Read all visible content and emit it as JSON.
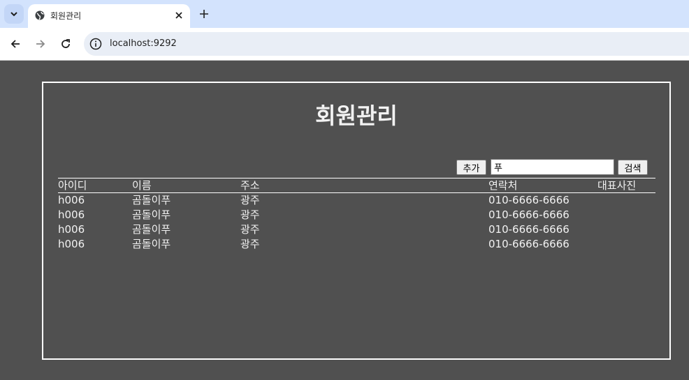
{
  "browser": {
    "tab_title": "회원관리",
    "url": "localhost:9292"
  },
  "page": {
    "title": "회원관리",
    "add_label": "추가",
    "search_value": "푸",
    "search_label": "검색",
    "columns": [
      "아이디",
      "이름",
      "주소",
      "연락처",
      "대표사진"
    ],
    "rows": [
      {
        "id": "h006",
        "name": "곰돌이푸",
        "addr": "광주",
        "tel": "010-6666-6666"
      },
      {
        "id": "h006",
        "name": "곰돌이푸",
        "addr": "광주",
        "tel": "010-6666-6666"
      },
      {
        "id": "h006",
        "name": "곰돌이푸",
        "addr": "광주",
        "tel": "010-6666-6666"
      },
      {
        "id": "h006",
        "name": "곰돌이푸",
        "addr": "광주",
        "tel": "010-6666-6666"
      }
    ]
  }
}
